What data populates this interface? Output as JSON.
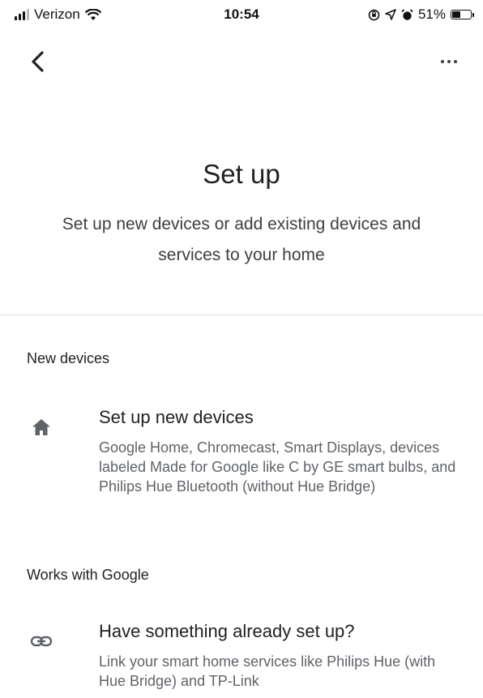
{
  "status_bar": {
    "carrier": "Verizon",
    "time": "10:54",
    "battery": "51%",
    "battery_level": 0.51
  },
  "header": {
    "title": "Set up",
    "subtitle": "Set up new devices or add existing devices and services to your home"
  },
  "sections": [
    {
      "header": "New devices",
      "item": {
        "icon": "home-icon",
        "title": "Set up new devices",
        "description": "Google Home, Chromecast, Smart Displays, devices labeled Made for Google like C by GE smart bulbs, and Philips Hue Bluetooth (without Hue Bridge)"
      }
    },
    {
      "header": "Works with Google",
      "item": {
        "icon": "link-icon",
        "title": "Have something already set up?",
        "description": "Link your smart home services like Philips Hue (with Hue Bridge) and TP-Link"
      }
    }
  ]
}
